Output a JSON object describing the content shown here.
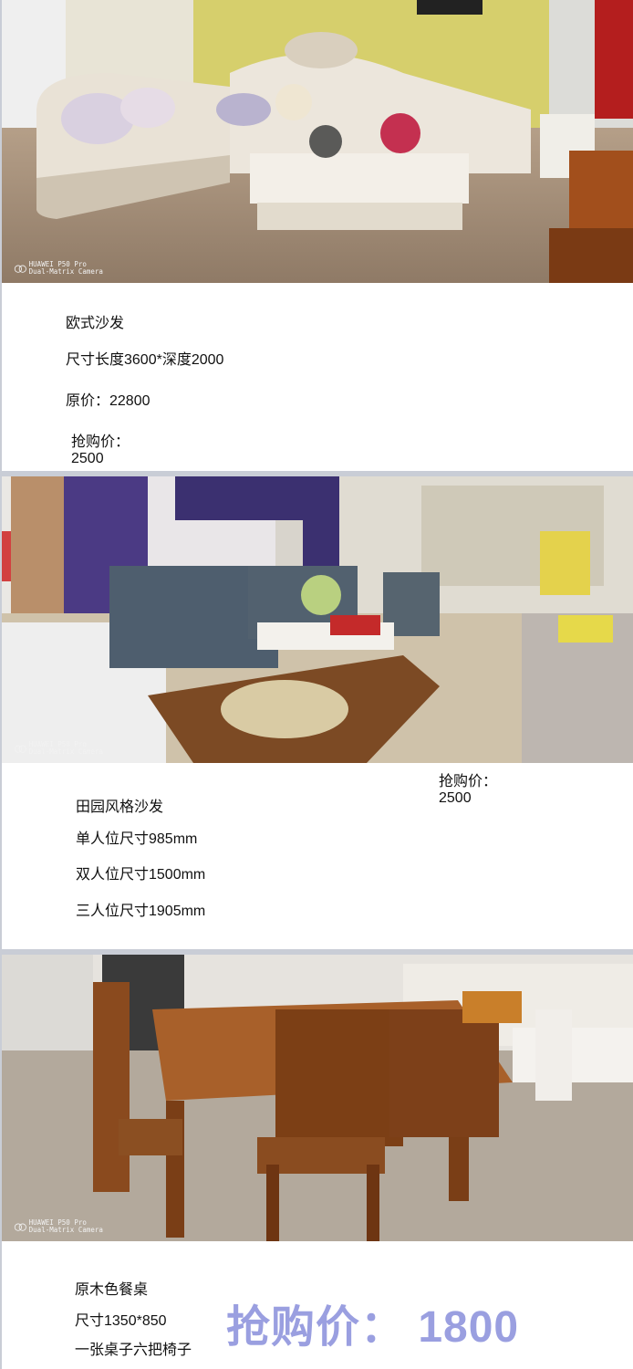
{
  "camera": {
    "line1": "HUAWEI P50 Pro",
    "line2": "Dual-Matrix Camera",
    "icon": "camera-rings-icon"
  },
  "product1": {
    "name": "欧式沙发",
    "size": "尺寸长度3600*深度2000",
    "original_price": "原价：22800",
    "sale_label": "抢购价：",
    "sale_value": "2500"
  },
  "product2": {
    "name": "田园风格沙发",
    "size_single": "单人位尺寸985mm",
    "size_double": "双人位尺寸1500mm",
    "size_triple": "三人位尺寸1905mm",
    "sale_label": "抢购价：",
    "sale_value": "2500"
  },
  "product3": {
    "name": "原木色餐桌",
    "size": "尺寸1350*850",
    "set": "一张桌子六把椅子",
    "sale_price": "抢购价： 1800"
  },
  "colors": {
    "sale_accent": "#9a9fe0",
    "separator": "#c9cdd6"
  }
}
